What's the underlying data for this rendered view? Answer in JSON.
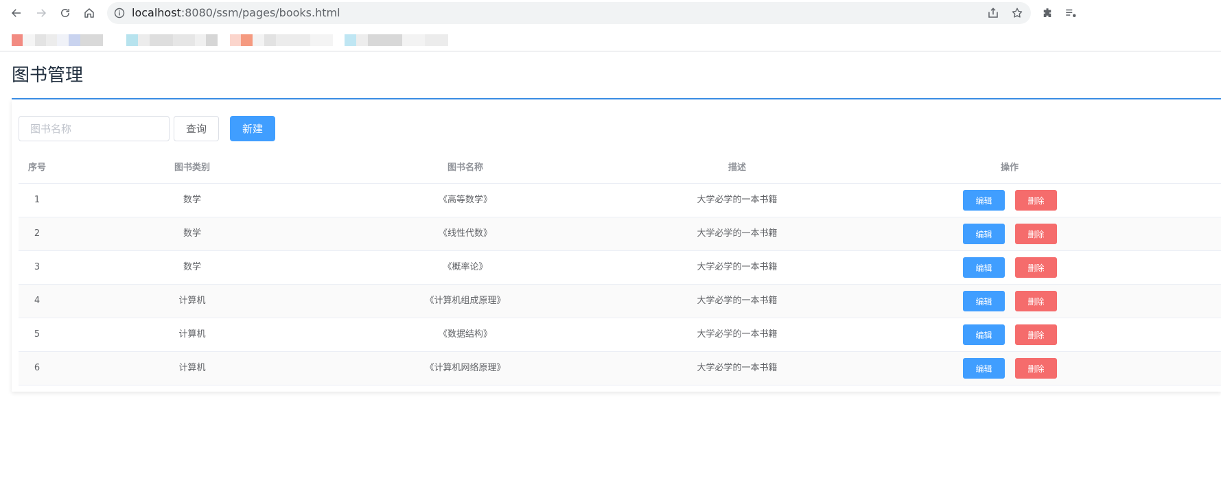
{
  "browser": {
    "url_host": "localhost",
    "url_path": ":8080/ssm/pages/books.html"
  },
  "bookmarks": [
    {
      "accent": "#f28b82"
    },
    {
      "accent": "#a8d8ea"
    },
    {
      "accent": "#f4a58a"
    },
    {
      "accent": "#b3e0f2"
    }
  ],
  "page": {
    "title": "图书管理"
  },
  "search": {
    "placeholder": "图书名称",
    "query_label": "查询",
    "new_label": "新建"
  },
  "table": {
    "headers": {
      "no": "序号",
      "category": "图书类别",
      "name": "图书名称",
      "description": "描述",
      "operations": "操作"
    },
    "rows": [
      {
        "no": "1",
        "category": "数学",
        "name": "《高等数学》",
        "description": "大学必学的一本书籍"
      },
      {
        "no": "2",
        "category": "数学",
        "name": "《线性代数》",
        "description": "大学必学的一本书籍"
      },
      {
        "no": "3",
        "category": "数学",
        "name": "《概率论》",
        "description": "大学必学的一本书籍"
      },
      {
        "no": "4",
        "category": "计算机",
        "name": "《计算机组成原理》",
        "description": "大学必学的一本书籍"
      },
      {
        "no": "5",
        "category": "计算机",
        "name": "《数据结构》",
        "description": "大学必学的一本书籍"
      },
      {
        "no": "6",
        "category": "计算机",
        "name": "《计算机网络原理》",
        "description": "大学必学的一本书籍"
      }
    ],
    "edit_label": "编辑",
    "delete_label": "删除"
  },
  "colors": {
    "primary": "#409eff",
    "danger": "#f56c6c",
    "title_rule": "#3a8ee6"
  }
}
